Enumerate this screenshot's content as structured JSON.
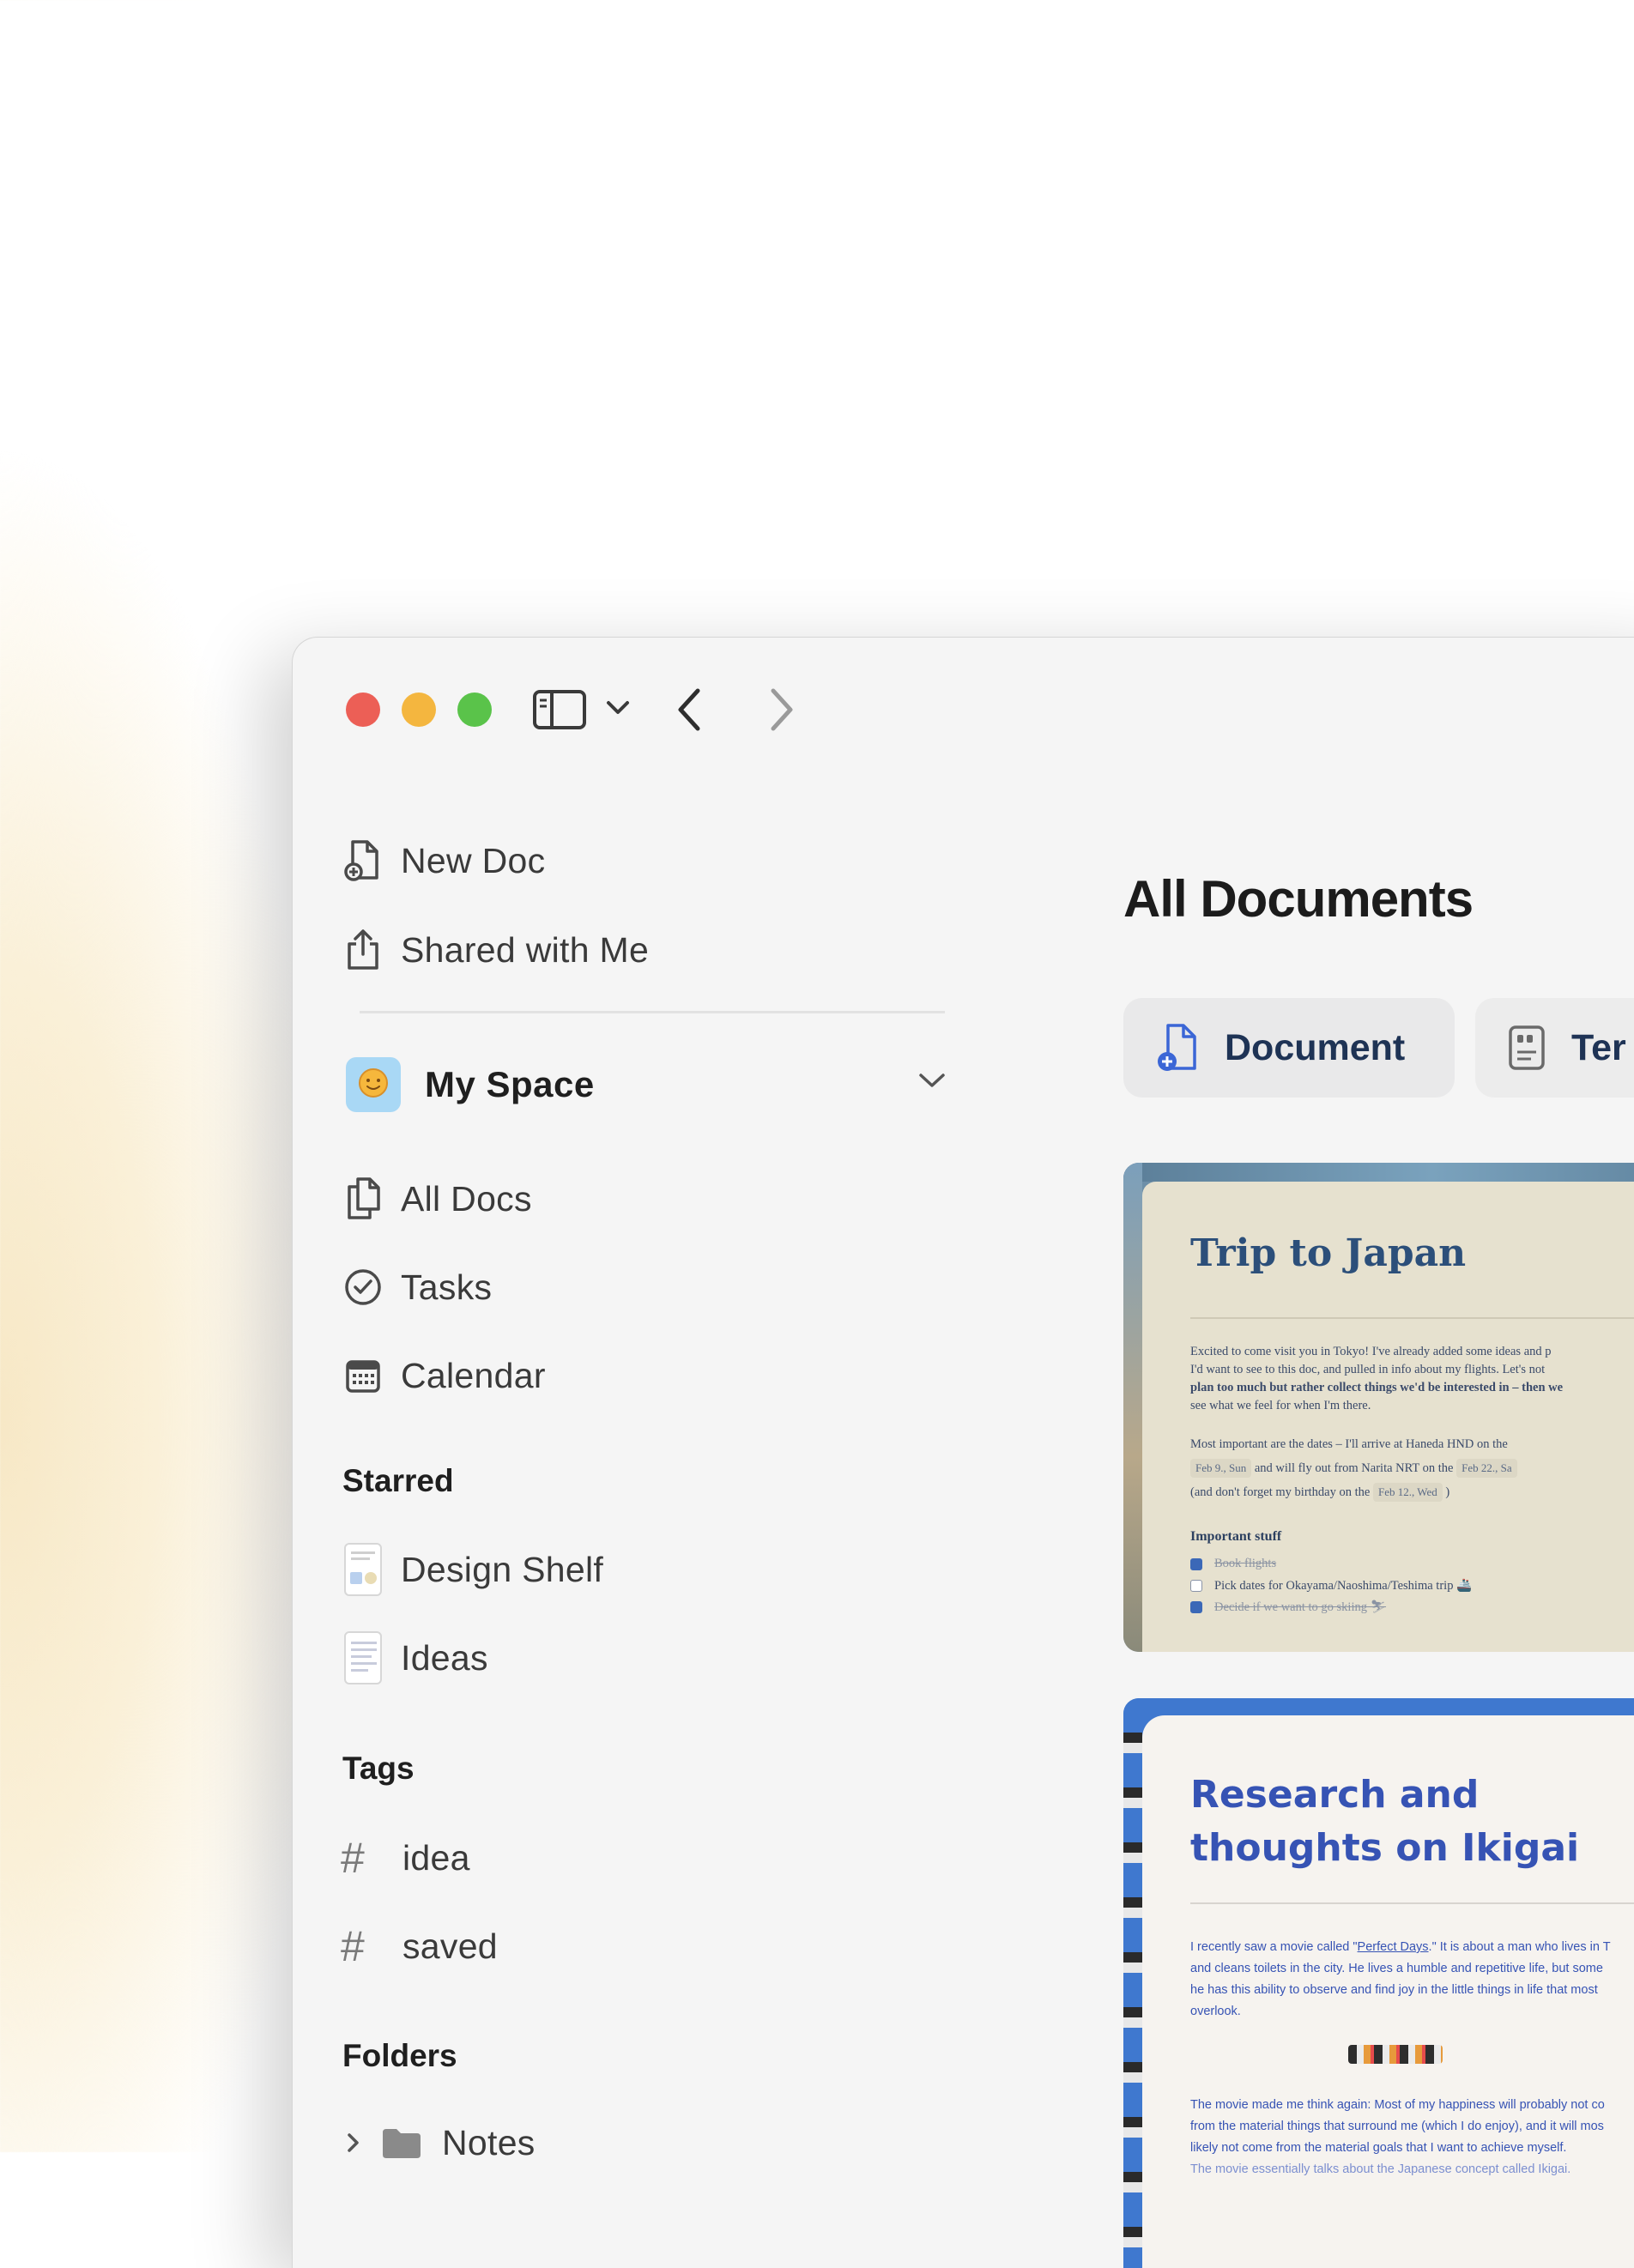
{
  "sidebar": {
    "top_items": [
      {
        "label": "New Doc",
        "icon": "new-doc-icon"
      },
      {
        "label": "Shared with Me",
        "icon": "share-icon"
      }
    ],
    "space": {
      "name": "My Space",
      "avatar_icon": "smiley-icon",
      "avatar_color": "#a9d8f5"
    },
    "nav_items": [
      {
        "label": "All Docs",
        "icon": "docs-icon"
      },
      {
        "label": "Tasks",
        "icon": "check-circle-icon"
      },
      {
        "label": "Calendar",
        "icon": "calendar-icon"
      }
    ],
    "starred": {
      "title": "Starred",
      "items": [
        {
          "label": "Design Shelf"
        },
        {
          "label": "Ideas"
        }
      ]
    },
    "tags": {
      "title": "Tags",
      "items": [
        {
          "label": "idea"
        },
        {
          "label": "saved"
        }
      ]
    },
    "folders": {
      "title": "Folders",
      "items": [
        {
          "label": "Notes"
        }
      ]
    }
  },
  "main": {
    "title": "All Documents",
    "chips": [
      {
        "label": "Document",
        "icon": "new-doc-icon"
      },
      {
        "label": "Ter",
        "icon": "template-icon"
      }
    ],
    "cards": {
      "japan": {
        "title": "Trip to Japan",
        "para_lines": [
          "Excited to come visit you in Tokyo! I've already added some ideas and p",
          "I'd want to see to this doc, and pulled in info about my flights. Let's not",
          "plan too much but rather collect things we'd be interested in – then we",
          "see what we feel for when I'm there."
        ],
        "box_line1": "Most important are the dates – I'll arrive at Haneda HND on the",
        "date1": "Feb 9., Sun",
        "box_line2_mid": "and will fly out from Narita NRT on the",
        "date2": "Feb 22., Sa",
        "box_line3_pre": "(and don't forget my birthday on the",
        "date3": "Feb 12., Wed",
        "box_line3_post": ")",
        "heading": "Important stuff",
        "tasks": [
          {
            "text": "Book flights",
            "done": true
          },
          {
            "text": "Pick dates for Okayama/Naoshima/Teshima trip 🚢",
            "done": false
          },
          {
            "text": "Decide if we want to go skiing ⛷",
            "done": true
          }
        ]
      },
      "ikigai": {
        "title": "Research and\nthoughts on Ikigai",
        "para1_pre": "I recently saw a movie called \"",
        "para1_link": "Perfect Days",
        "para1_post": ".\" It is about a man who lives in T",
        "para1_lines": [
          "and cleans toilets in the city. He lives a humble and repetitive life, but some",
          "he has this ability to observe and find joy in the little things in life that most",
          "overlook."
        ],
        "para2_lines": [
          "The movie made me think again: Most of my happiness will probably not co",
          "from the material things that surround me (which I do enjoy), and it will mos",
          "likely not come from the material goals that I want to achieve myself.",
          "The movie essentially talks about the Japanese concept called Ikigai."
        ]
      }
    }
  }
}
